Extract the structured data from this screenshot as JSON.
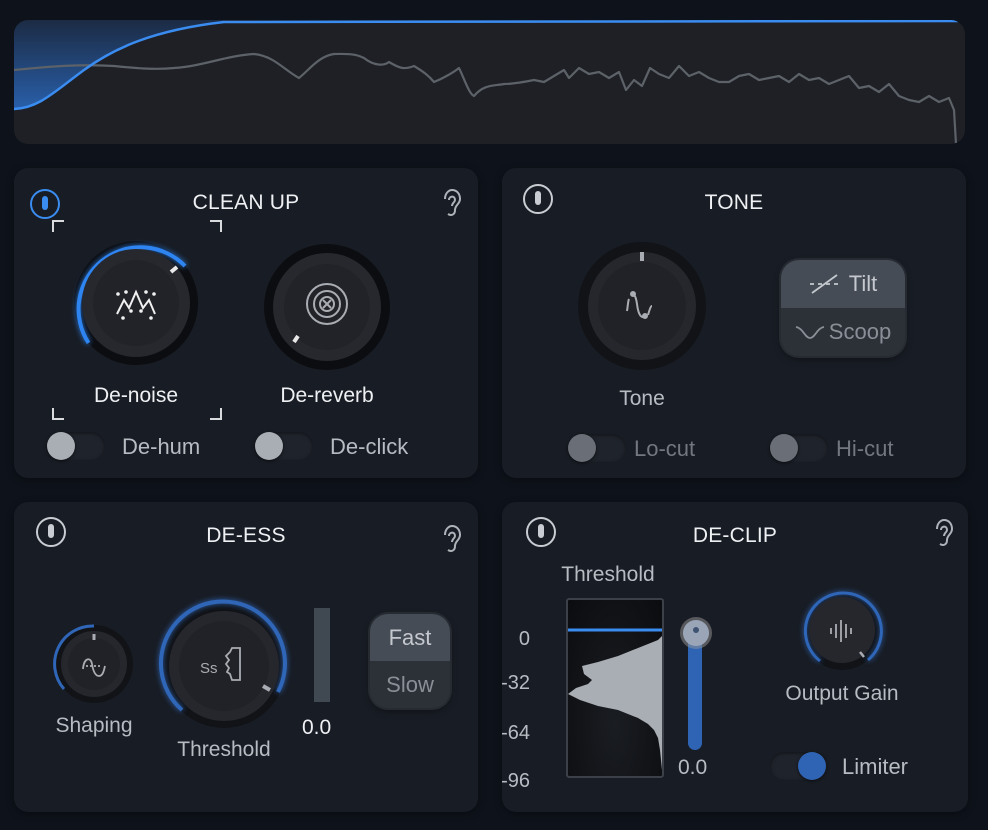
{
  "spectrum": {
    "label": "spectrum-display",
    "curve_color": "#3a8cf0",
    "trace_color": "#5c6268"
  },
  "cleanup": {
    "title": "CLEAN UP",
    "power_on": true,
    "knobs": [
      {
        "label": "De-noise",
        "icon": "noise-icon",
        "value_fraction": 0.6,
        "selected": true
      },
      {
        "label": "De-reverb",
        "icon": "reverb-icon",
        "value_fraction": 0.0,
        "selected": false
      }
    ],
    "toggles": [
      {
        "label": "De-hum",
        "on": false
      },
      {
        "label": "De-click",
        "on": false
      }
    ]
  },
  "tone": {
    "title": "TONE",
    "power_on": false,
    "knob": {
      "label": "Tone",
      "icon": "tone-curve-icon",
      "value_fraction": 0.5
    },
    "mode": {
      "options": [
        "Tilt",
        "Scoop"
      ],
      "selected": "Tilt"
    },
    "toggles": [
      {
        "label": "Lo-cut",
        "on": false
      },
      {
        "label": "Hi-cut",
        "on": false
      }
    ]
  },
  "deess": {
    "title": "DE-ESS",
    "power_on": false,
    "knobs": [
      {
        "label": "Shaping",
        "icon": "shaping-wave-icon",
        "value_fraction": 0.5
      },
      {
        "label": "Threshold",
        "icon": "sibilance-icon",
        "value_fraction": 0.82
      }
    ],
    "meter_value": "0.0",
    "speed": {
      "options": [
        "Fast",
        "Slow"
      ],
      "selected": "Fast"
    }
  },
  "declip": {
    "title": "DE-CLIP",
    "power_on": false,
    "threshold_label": "Threshold",
    "scale_ticks": [
      "0",
      "-32",
      "-64",
      "-96"
    ],
    "threshold_value": "0.0",
    "output_gain": {
      "label": "Output Gain",
      "icon": "waveform-icon",
      "value_fraction": 0.82
    },
    "limiter": {
      "label": "Limiter",
      "on": true
    }
  }
}
